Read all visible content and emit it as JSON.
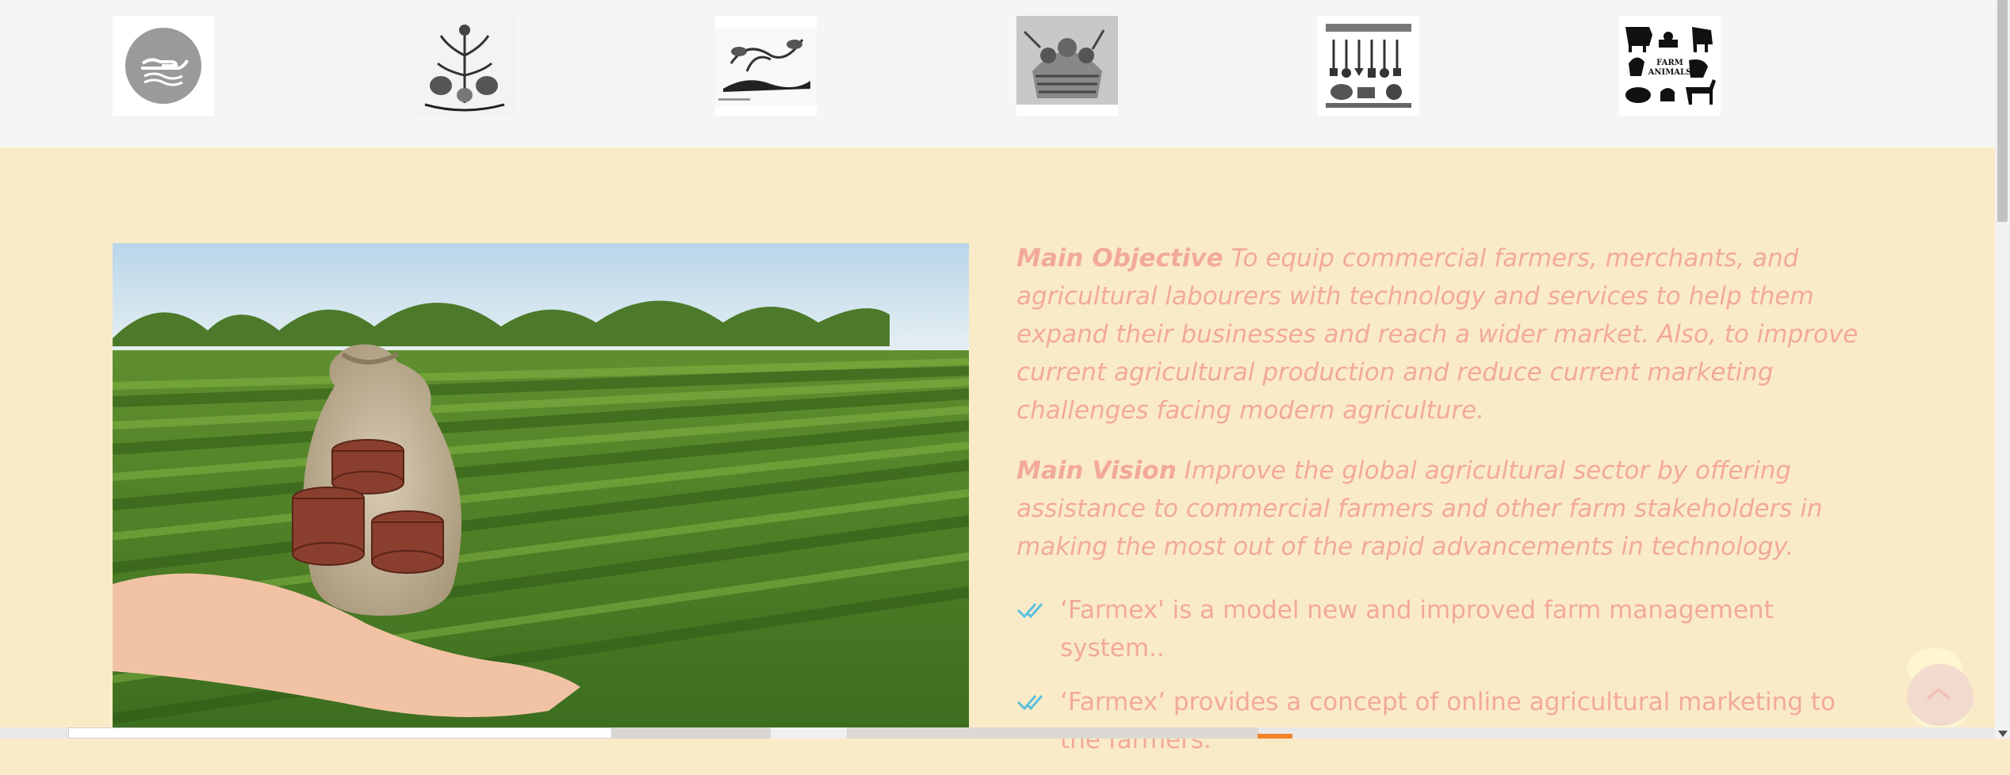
{
  "thumbnails": [
    {
      "icon": "hand-money-circle-icon"
    },
    {
      "icon": "plant-vegetables-icon"
    },
    {
      "icon": "sprouting-seed-icon"
    },
    {
      "icon": "harvest-basket-icon"
    },
    {
      "icon": "garden-tools-icon"
    },
    {
      "icon": "farm-animals-icon",
      "text": "FARM ANIMALS"
    }
  ],
  "hero": {
    "icon": "money-bag-farm-field-image"
  },
  "objective": {
    "heading": "Main Objective",
    "text": "To equip commercial farmers, merchants, and agricultural labourers with technology and services to help them expand their businesses and reach a wider market. Also, to improve current agricultural production and reduce current marketing challenges facing modern agriculture."
  },
  "vision": {
    "heading": "Main Vision",
    "text": "Improve the global agricultural sector by offering assistance to commercial farmers and other farm stakeholders in making the most out of the rapid advancements in technology."
  },
  "bullets": [
    "‘Farmex' is a model new and improved farm management system..",
    "‘Farmex’ provides a concept of online agricultural marketing to the farmers."
  ],
  "colors": {
    "page_bg": "#faebc8",
    "top_band_bg": "#f5f5f5",
    "text_accent": "#f2a99b",
    "check_color": "#5bc0de"
  },
  "back_to_top": {
    "icon": "chevron-up-icon"
  }
}
